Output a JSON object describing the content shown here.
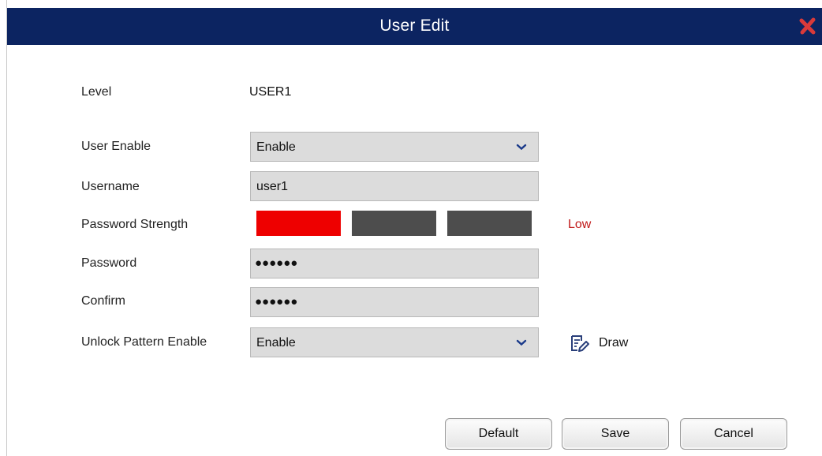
{
  "dialog": {
    "title": "User Edit",
    "close_icon": "close-x-icon",
    "close_color": "#d93a3a"
  },
  "form": {
    "level": {
      "label": "Level",
      "value": "USER1"
    },
    "user_enable": {
      "label": "User Enable",
      "value": "Enable"
    },
    "username": {
      "label": "Username",
      "value": "user1"
    },
    "password_strength": {
      "label": "Password Strength",
      "level_text": "Low",
      "filled_segments": 1,
      "total_segments": 3
    },
    "password": {
      "label": "Password",
      "value": "●●●●●●"
    },
    "confirm": {
      "label": "Confirm",
      "value": "●●●●●●"
    },
    "unlock_pattern": {
      "label": "Unlock Pattern Enable",
      "value": "Enable",
      "draw_label": "Draw",
      "draw_icon": "pen-edit-icon"
    }
  },
  "buttons": {
    "default": "Default",
    "save": "Save",
    "cancel": "Cancel"
  },
  "colors": {
    "titlebar": "#0c2461",
    "strength_low": "#ee0000",
    "strength_empty": "#4d4d4d",
    "strength_text": "#c01818"
  }
}
